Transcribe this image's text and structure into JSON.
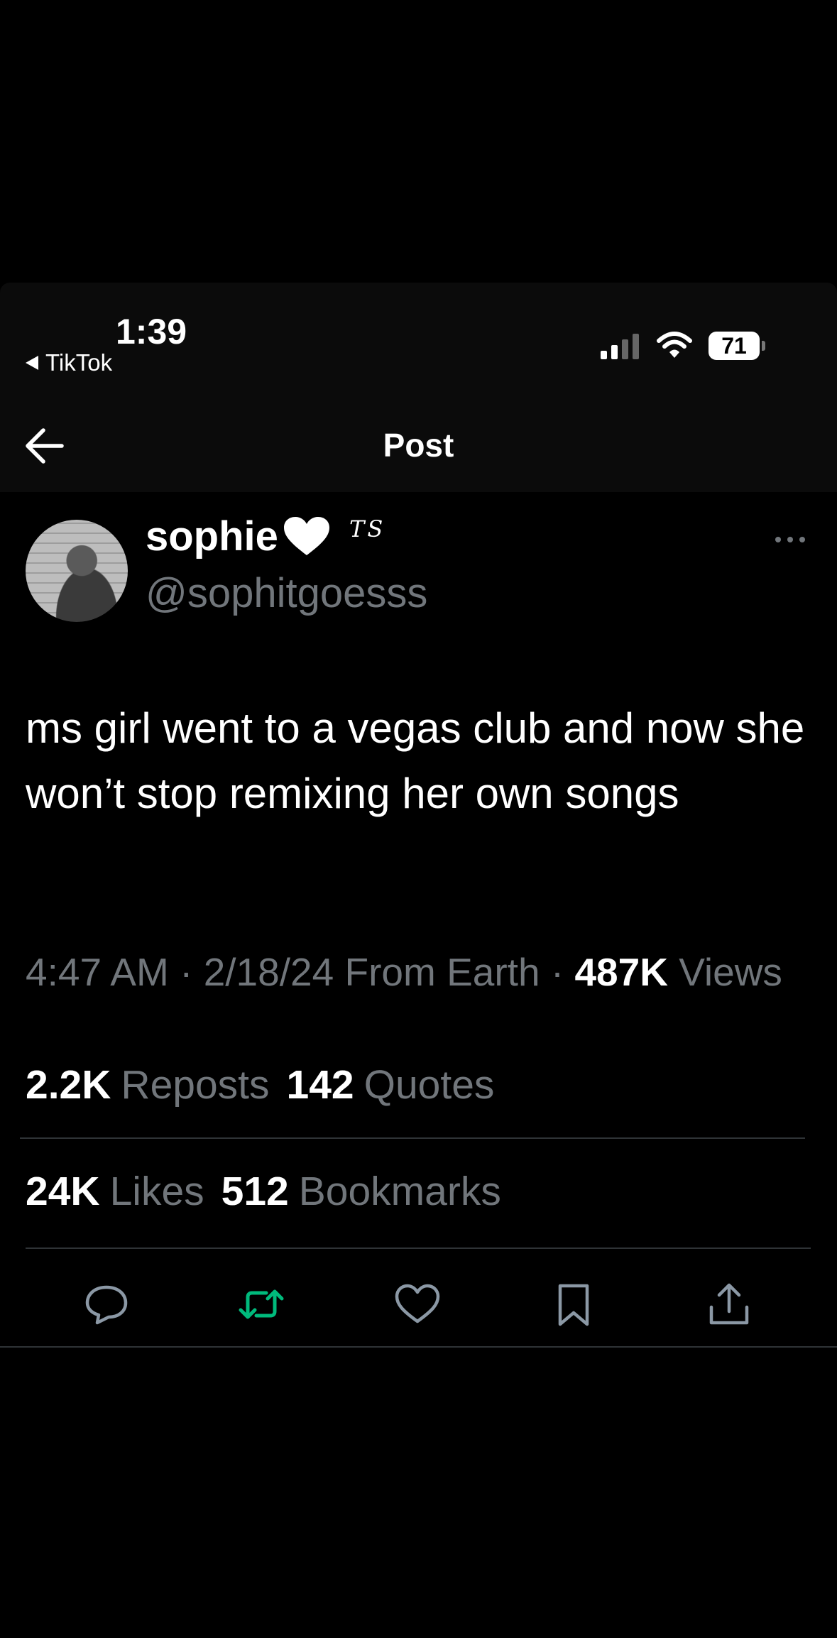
{
  "status_bar": {
    "time": "1:39",
    "back_app": "TikTok",
    "battery": "71",
    "icons": [
      "signal-icon",
      "wifi-icon",
      "battery-icon"
    ]
  },
  "header": {
    "title": "Post",
    "back_icon": "back-arrow-icon"
  },
  "author": {
    "display_name": "sophie",
    "name_emoji": "white-heart-icon",
    "badge_text": "TS",
    "handle": "@sophitgoesss"
  },
  "tweet": {
    "text": "ms girl went to a vegas club and now she won’t stop remixing her own songs"
  },
  "meta": {
    "time": "4:47 AM",
    "date": "2/18/24",
    "source": "From Earth",
    "views_count": "487K",
    "views_label": "Views"
  },
  "stats": {
    "reposts_count": "2.2K",
    "reposts_label": "Reposts",
    "quotes_count": "142",
    "quotes_label": "Quotes",
    "likes_count": "24K",
    "likes_label": "Likes",
    "bookmarks_count": "512",
    "bookmarks_label": "Bookmarks"
  },
  "actions": [
    "reply-icon",
    "repost-icon",
    "like-icon",
    "bookmark-icon",
    "share-icon"
  ],
  "colors": {
    "background": "#000000",
    "text": "#e7e9ea",
    "secondary_text": "#71767b",
    "repost_accent": "#00ba7c"
  }
}
